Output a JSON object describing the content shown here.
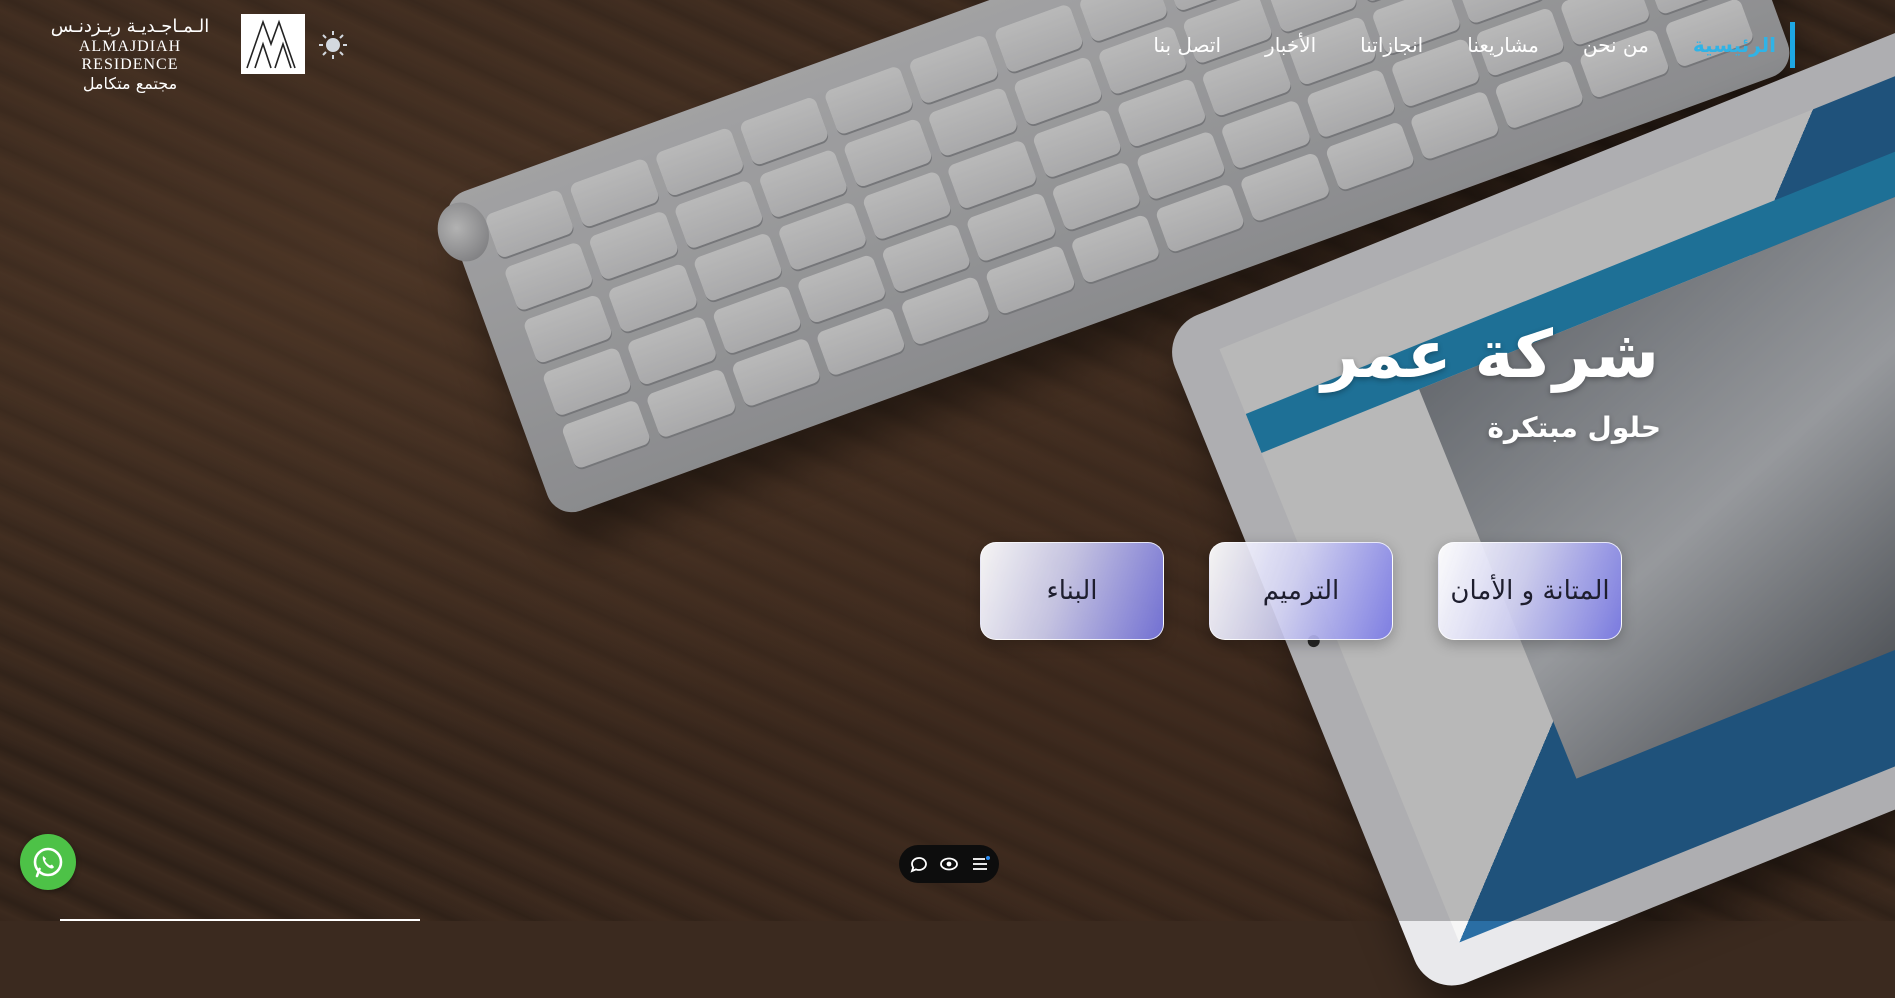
{
  "logo": {
    "arabic_name": "الـمـاجـديـة ريـزدنـس",
    "english_name": "ALMAJDIAH RESIDENCE",
    "tagline": "مجتمع متكامل",
    "mark_icon": "almajdiah-logo-mark"
  },
  "theme_toggle": {
    "icon": "sun-icon"
  },
  "nav": {
    "items": [
      {
        "label": "الرئيسية",
        "active": true
      },
      {
        "label": "من نحن",
        "active": false
      },
      {
        "label": "مشاريعنا",
        "active": false
      },
      {
        "label": "انجازاتنا",
        "active": false
      },
      {
        "label": "الأخبار",
        "active": false
      },
      {
        "label": "اتصل بنا",
        "active": false
      }
    ]
  },
  "hero": {
    "title": "شركة عمر",
    "subtitle": "حلول مبتكرة"
  },
  "cards": [
    {
      "label": "المتانة و الأمان"
    },
    {
      "label": "الترميم"
    },
    {
      "label": "البناء"
    }
  ],
  "whatsapp": {
    "icon": "whatsapp-icon",
    "color": "#4dc247"
  },
  "bottom_bar": {
    "icons": [
      "chat-bubble-icon",
      "eye-icon",
      "menu-list-icon"
    ]
  },
  "colors": {
    "accent": "#1ea7e3",
    "active_nav": "#30b3e6",
    "whatsapp": "#4dc247"
  }
}
